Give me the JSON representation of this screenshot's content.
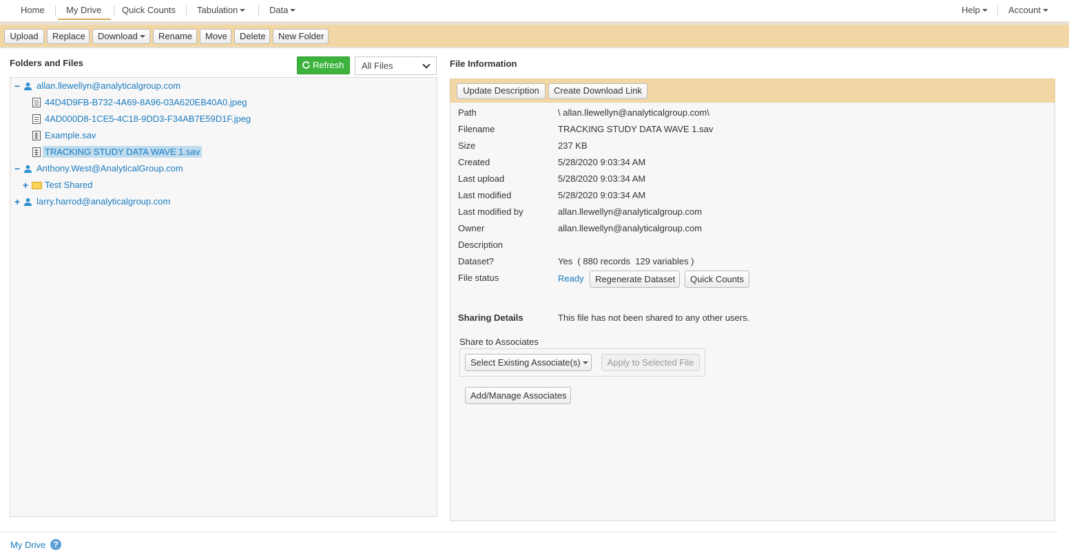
{
  "nav": {
    "home": "Home",
    "my_drive": "My Drive",
    "quick_counts": "Quick Counts",
    "tabulation": "Tabulation",
    "data": "Data",
    "help": "Help",
    "account": "Account"
  },
  "toolbar": {
    "upload": "Upload",
    "replace": "Replace",
    "download": "Download",
    "rename": "Rename",
    "move": "Move",
    "delete": "Delete",
    "new_folder": "New Folder"
  },
  "left": {
    "title": "Folders and Files",
    "refresh": "Refresh",
    "filter_value": "All Files"
  },
  "tree": [
    {
      "label": "allan.llewellyn@analyticalgroup.com",
      "kind": "user",
      "toggle": "−"
    },
    {
      "label": "44D4D9FB-B732-4A69-8A96-03A620EB40A0.jpeg",
      "kind": "file"
    },
    {
      "label": "4AD000D8-1CE5-4C18-9DD3-F34AB7E59D1F.jpeg",
      "kind": "file"
    },
    {
      "label": "Example.sav",
      "kind": "sav"
    },
    {
      "label": "TRACKING STUDY DATA WAVE 1.sav",
      "kind": "sav",
      "selected": true
    },
    {
      "label": "Anthony.West@AnalyticalGroup.com",
      "kind": "user",
      "toggle": "−"
    },
    {
      "label": "Test Shared",
      "kind": "folder",
      "toggle": "+"
    },
    {
      "label": "larry.harrod@analyticalgroup.com",
      "kind": "user",
      "toggle": "+"
    }
  ],
  "right": {
    "title": "File Information",
    "update_description": "Update Description",
    "create_download_link": "Create Download Link",
    "fields": {
      "path_label": "Path",
      "path_value": "\\ allan.llewellyn@analyticalgroup.com\\",
      "filename_label": "Filename",
      "filename_value": "TRACKING STUDY DATA WAVE 1.sav",
      "size_label": "Size",
      "size_value": "237 KB",
      "created_label": "Created",
      "created_value": "5/28/2020 9:03:34 AM",
      "last_upload_label": "Last upload",
      "last_upload_value": "5/28/2020 9:03:34 AM",
      "last_modified_label": "Last modified",
      "last_modified_value": "5/28/2020 9:03:34 AM",
      "last_modified_by_label": "Last modified by",
      "last_modified_by_value": "allan.llewellyn@analyticalgroup.com",
      "owner_label": "Owner",
      "owner_value": "allan.llewellyn@analyticalgroup.com",
      "description_label": "Description",
      "dataset_label": "Dataset?",
      "dataset_value": "Yes  ( 880 records  129 variables )",
      "file_status_label": "File status",
      "file_status_value": "Ready",
      "regenerate_dataset": "Regenerate Dataset",
      "quick_counts": "Quick Counts"
    },
    "sharing": {
      "label": "Sharing Details",
      "value": "This file has not been shared to any other users.",
      "share_to_associates": "Share to Associates",
      "select_existing": "Select Existing Associate(s)",
      "apply_selected": "Apply to Selected File",
      "add_manage": "Add/Manage Associates"
    }
  },
  "footer": {
    "my_drive_link": "My Drive",
    "help_glyph": "?"
  },
  "colors": {
    "toolbar_bg": "#f2d7a4",
    "link": "#1a7bbf",
    "refresh_green": "#3cb33c",
    "selection": "#bfdcee"
  }
}
